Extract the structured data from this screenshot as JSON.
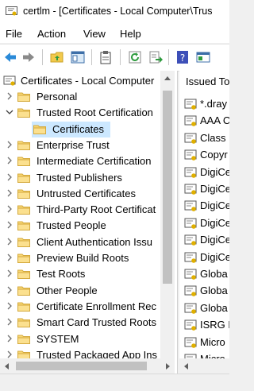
{
  "window": {
    "title": "certlm - [Certificates - Local Computer\\Trus"
  },
  "menu": [
    "File",
    "Action",
    "View",
    "Help"
  ],
  "toolbar": {
    "icons": [
      "back-arrow-icon",
      "forward-arrow-icon",
      "up-folder-icon",
      "show-hide-tree-icon",
      "properties-icon",
      "refresh-icon",
      "export-list-icon",
      "help-icon",
      "console-icon"
    ]
  },
  "tree": {
    "root": "Certificates - Local Computer",
    "items": [
      {
        "label": "Personal",
        "expanded": false
      },
      {
        "label": "Trusted Root Certification",
        "expanded": true
      },
      {
        "label": "Certificates",
        "child": true,
        "selected": true
      },
      {
        "label": "Enterprise Trust",
        "expanded": false
      },
      {
        "label": "Intermediate Certification",
        "expanded": false
      },
      {
        "label": "Trusted Publishers",
        "expanded": false
      },
      {
        "label": "Untrusted Certificates",
        "expanded": false
      },
      {
        "label": "Third-Party Root Certificat",
        "expanded": false
      },
      {
        "label": "Trusted People",
        "expanded": false
      },
      {
        "label": "Client Authentication Issu",
        "expanded": false
      },
      {
        "label": "Preview Build Roots",
        "expanded": false
      },
      {
        "label": "Test Roots",
        "expanded": false
      },
      {
        "label": "Other People",
        "expanded": false
      },
      {
        "label": "Certificate Enrollment Rec",
        "expanded": false
      },
      {
        "label": "Smart Card Trusted Roots",
        "expanded": false
      },
      {
        "label": "SYSTEM",
        "expanded": false
      },
      {
        "label": "Trusted Packaged App Ins",
        "expanded": false
      }
    ]
  },
  "list": {
    "header": "Issued To",
    "items": [
      "*.dray",
      "AAA C",
      "Class",
      "Copyr",
      "DigiCe",
      "DigiCe",
      "DigiCe",
      "DigiCe",
      "DigiCe",
      "DigiCe",
      "Globa",
      "Globa",
      "Globa",
      "ISRG R",
      "Micro",
      "Micro"
    ]
  },
  "colors": {
    "selection": "#cce8ff",
    "accent": "#0078d7"
  }
}
